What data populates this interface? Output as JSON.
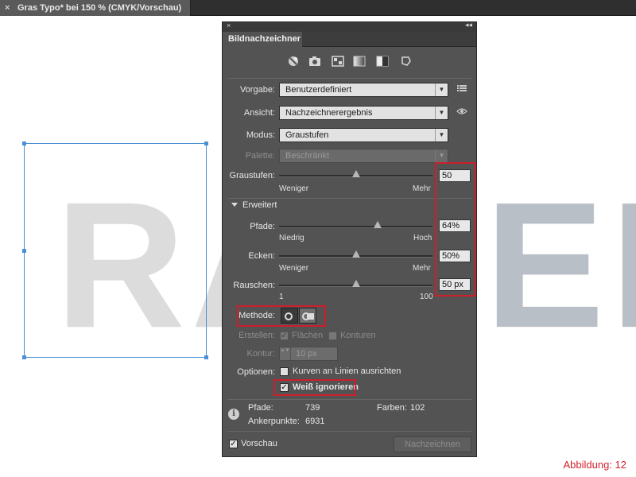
{
  "document": {
    "tab_title": "Gras Typo* bei 150 % (CMYK/Vorschau)",
    "close_glyph": "×"
  },
  "artwork": {
    "left_text": "RA",
    "right_text": "EN"
  },
  "panel": {
    "title": "Bildnachzeichner",
    "close_glyph": "×",
    "collapse_glyph": "◂◂",
    "top_icons": [
      "auto-color-icon",
      "high-color-icon",
      "low-color-icon",
      "grayscale-icon",
      "black-white-icon",
      "outline-icon"
    ],
    "vorgabe": {
      "label": "Vorgabe:",
      "value": "Benutzerdefiniert"
    },
    "ansicht": {
      "label": "Ansicht:",
      "value": "Nachzeichnerergebnis"
    },
    "modus": {
      "label": "Modus:",
      "value": "Graustufen"
    },
    "palette": {
      "label": "Palette:",
      "value": "Beschränkt"
    },
    "graustufen": {
      "label": "Graustufen:",
      "value": "50",
      "min_label": "Weniger",
      "max_label": "Mehr",
      "level": 0.5
    },
    "erweitert": {
      "label": "Erweitert"
    },
    "pfade": {
      "label": "Pfade:",
      "value": "64%",
      "min_label": "Niedrig",
      "max_label": "Hoch",
      "level": 0.64
    },
    "ecken": {
      "label": "Ecken:",
      "value": "50%",
      "min_label": "Weniger",
      "max_label": "Mehr",
      "level": 0.5
    },
    "rauschen": {
      "label": "Rauschen:",
      "value": "50 px",
      "min_label": "1",
      "max_label": "100",
      "level": 0.5
    },
    "methode": {
      "label": "Methode:"
    },
    "erstellen": {
      "label": "Erstellen:",
      "flaechen": "Flächen",
      "konturen": "Konturen"
    },
    "kontur": {
      "label": "Kontur:",
      "value": "10 px"
    },
    "optionen": {
      "label": "Optionen:",
      "kurven": "Kurven an Linien ausrichten",
      "weiss": "Weiß ignorieren"
    },
    "stats": {
      "pfade_label": "Pfade:",
      "pfade_value": "739",
      "farben_label": "Farben:",
      "farben_value": "102",
      "anker_label": "Ankerpunkte:",
      "anker_value": "6931"
    },
    "vorschau": "Vorschau",
    "nachzeichnen": "Nachzeichnen",
    "check_glyph": "✓",
    "arrow_glyph": "▼",
    "info_glyph": "i",
    "spin_glyph": "▲▼"
  },
  "caption": "Abbildung: 12",
  "colors": {
    "highlight": "#cc1f2b",
    "selection": "#4a90d9",
    "panel_bg": "#535353"
  }
}
